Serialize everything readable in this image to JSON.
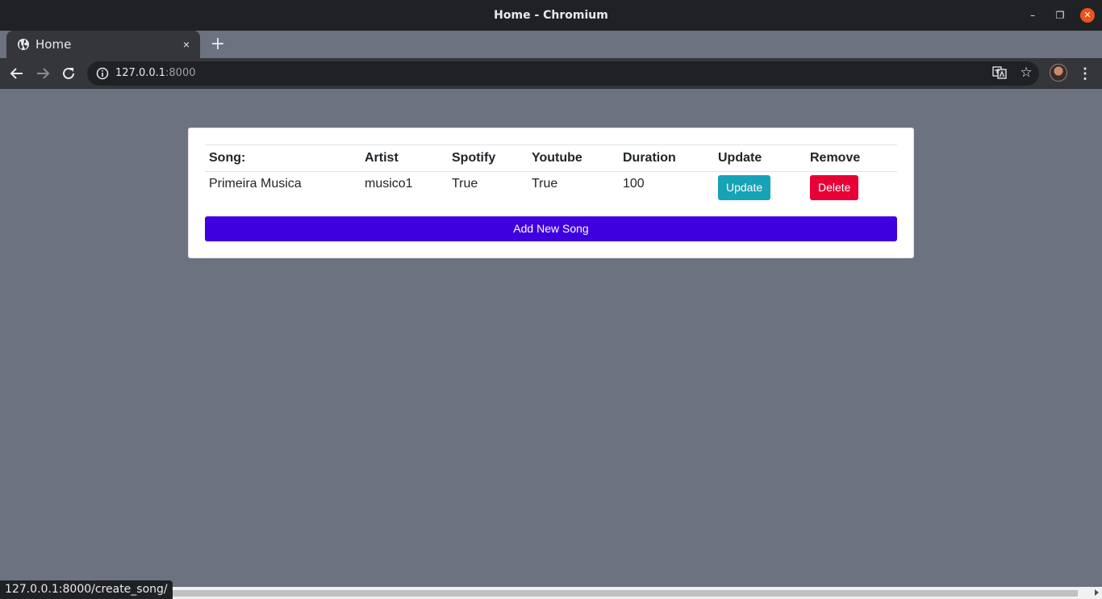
{
  "window": {
    "title": "Home - Chromium"
  },
  "tab": {
    "title": "Home",
    "close": "×"
  },
  "new_tab": "+",
  "address_bar": {
    "host": "127.0.0.1",
    "port": ":8000"
  },
  "table": {
    "headers": [
      "Song:",
      "Artist",
      "Spotify",
      "Youtube",
      "Duration",
      "Update",
      "Remove"
    ],
    "rows": [
      {
        "song": "Primeira Musica",
        "artist": "musico1",
        "spotify": "True",
        "youtube": "True",
        "duration": "100",
        "update_label": "Update",
        "delete_label": "Delete"
      }
    ]
  },
  "add_button_label": "Add New Song",
  "status_bar": "127.0.0.1:8000/create_song/",
  "colors": {
    "update_button": "#17a2b8",
    "delete_button": "#e60035",
    "add_button": "#3f00e0",
    "page_background": "#6c727f"
  },
  "icons": {
    "tab_favicon": "globe-icon",
    "back": "arrow-left-icon",
    "forward": "arrow-right-icon",
    "reload": "reload-icon",
    "site_info": "info-icon",
    "translate": "translate-icon",
    "bookmark": "star-icon",
    "profile": "avatar",
    "menu": "kebab-menu-icon"
  }
}
